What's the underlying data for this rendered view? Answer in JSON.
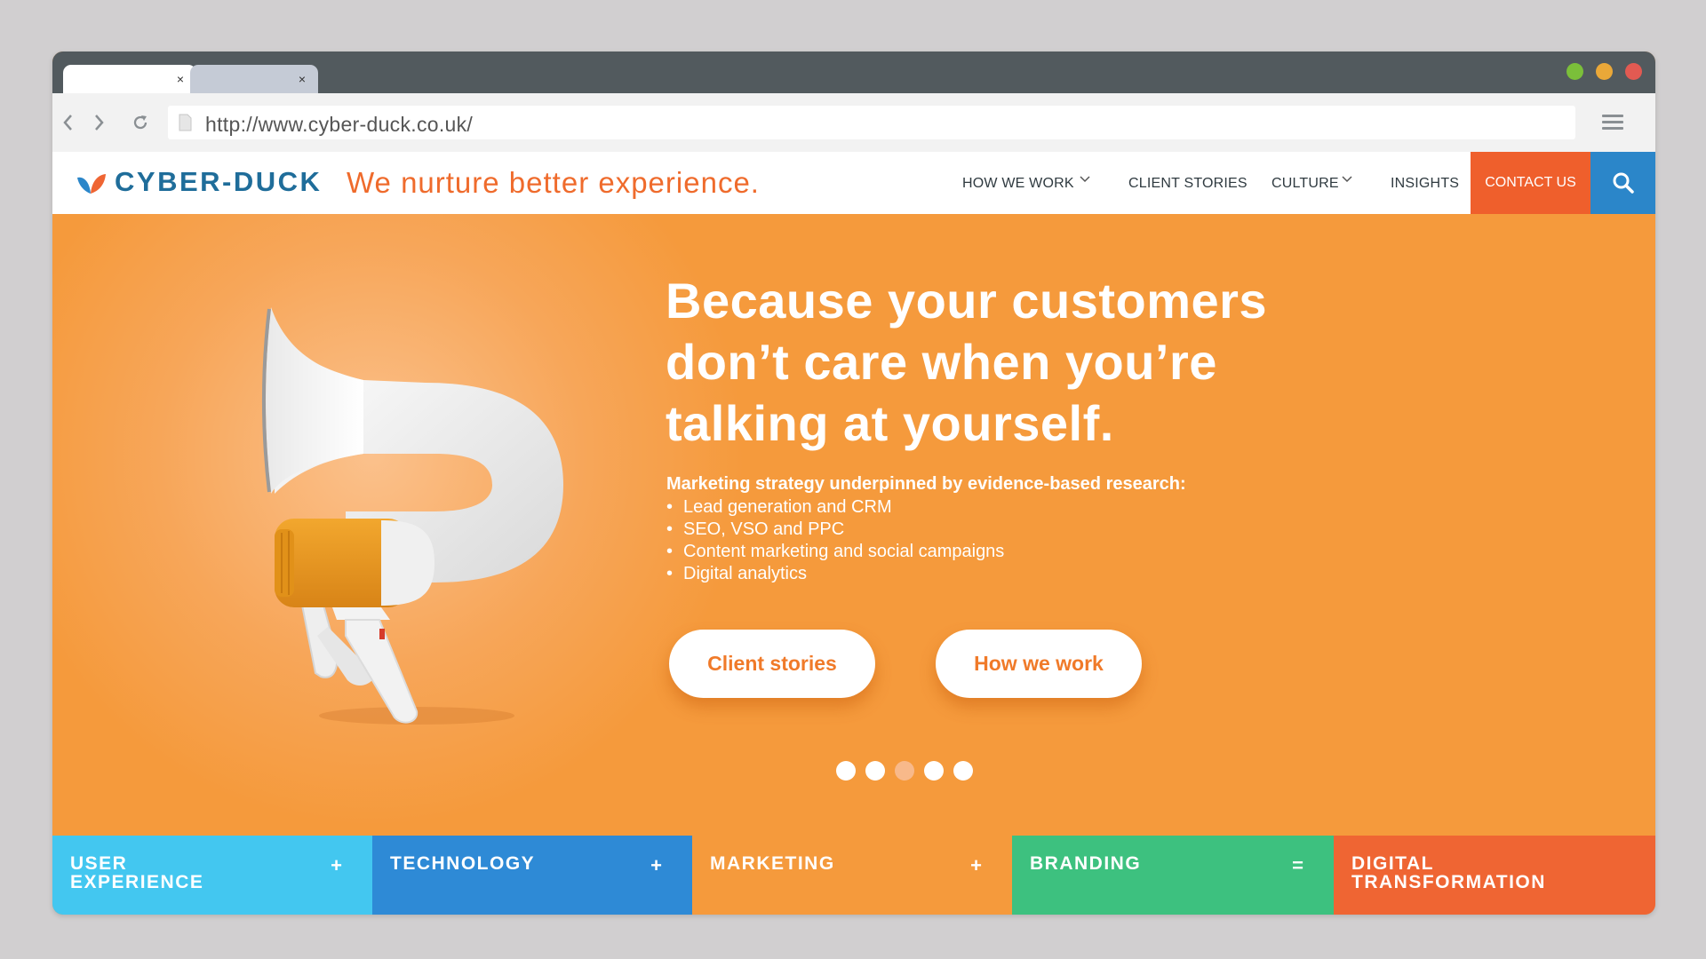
{
  "browser": {
    "tabs": [
      {
        "close": "×",
        "active": true
      },
      {
        "close": "×",
        "active": false
      }
    ],
    "url": "http://www.cyber-duck.co.uk/",
    "window_controls": {
      "colors": [
        "#7bbf3a",
        "#eaa838",
        "#e25a52"
      ]
    },
    "icons": [
      "back-arrow-icon",
      "forward-arrow-icon",
      "reload-icon",
      "page-icon",
      "hamburger-menu-icon"
    ]
  },
  "site": {
    "logo": "CYBER-DUCK",
    "tagline": "We nurture better experience.",
    "nav": [
      {
        "label": "HOW WE WORK",
        "dropdown": true
      },
      {
        "label": "CLIENT STORIES",
        "dropdown": false
      },
      {
        "label": "CULTURE",
        "dropdown": true
      },
      {
        "label": "INSIGHTS",
        "dropdown": false
      }
    ],
    "contact": "CONTACT US",
    "colors": {
      "brand_blue": "#1f6d9a",
      "accent_orange": "#ef6b2c",
      "hero_orange": "#f59a3c",
      "search_blue": "#2b86c9"
    }
  },
  "hero": {
    "headline_lines": [
      "Because your customers",
      "don’t care when you’re",
      "talking at yourself."
    ],
    "subhead": "Marketing strategy underpinned by evidence-based research:",
    "bullets": [
      "Lead generation and CRM",
      "SEO, VSO and PPC",
      "Content marketing and social campaigns",
      "Digital analytics"
    ],
    "buttons": [
      "Client stories",
      "How we work"
    ],
    "pager": {
      "count": 5,
      "active_index": 2
    }
  },
  "tiles": [
    {
      "label": "USER EXPERIENCE",
      "symbol": "+",
      "color": "#43c7f0"
    },
    {
      "label": "TECHNOLOGY",
      "symbol": "+",
      "color": "#2e8ad6"
    },
    {
      "label": "MARKETING",
      "symbol": "+",
      "color": "#f59a3c"
    },
    {
      "label": "BRANDING",
      "symbol": "=",
      "color": "#3dc17f"
    },
    {
      "label": "DIGITAL TRANSFORMATION",
      "symbol": "",
      "color": "#ef6533"
    }
  ]
}
